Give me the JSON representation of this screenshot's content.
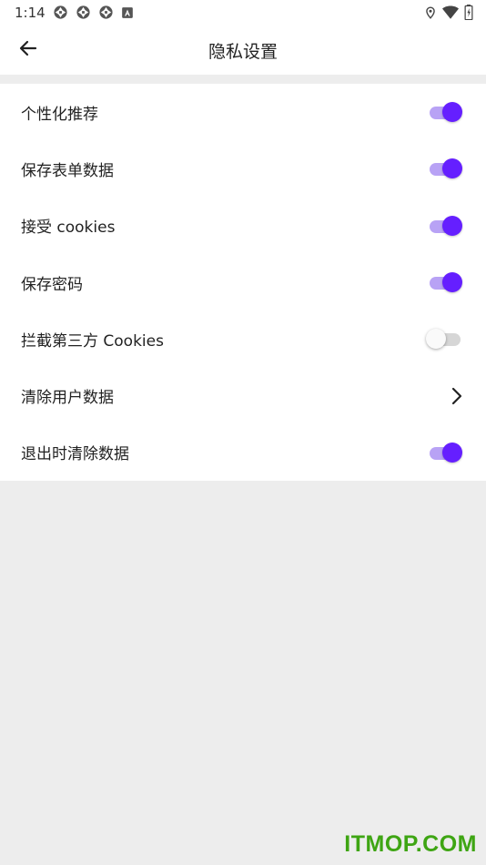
{
  "status_bar": {
    "time": "1:14",
    "left_icons": [
      "aperture-icon",
      "aperture-icon",
      "aperture-icon",
      "a-box-icon"
    ],
    "right_icons": [
      "location-icon",
      "wifi-icon",
      "battery-icon"
    ]
  },
  "header": {
    "title": "隐私设置",
    "back_icon": "arrow-back-icon"
  },
  "settings": [
    {
      "label": "个性化推荐",
      "control": "toggle",
      "checked": true
    },
    {
      "label": "保存表单数据",
      "control": "toggle",
      "checked": true
    },
    {
      "label": "接受 cookies",
      "control": "toggle",
      "checked": true
    },
    {
      "label": "保存密码",
      "control": "toggle",
      "checked": true
    },
    {
      "label": "拦截第三方 Cookies",
      "control": "toggle",
      "checked": false
    },
    {
      "label": "清除用户数据",
      "control": "chevron",
      "icon": "chevron-right-icon"
    },
    {
      "label": "退出时清除数据",
      "control": "toggle",
      "checked": true
    }
  ],
  "watermark": "ITMOP.COM",
  "colors": {
    "accent": "#651fff",
    "accent_track": "#b8a2f5",
    "background": "#ededed",
    "surface": "#ffffff",
    "watermark": "#3ea513"
  }
}
